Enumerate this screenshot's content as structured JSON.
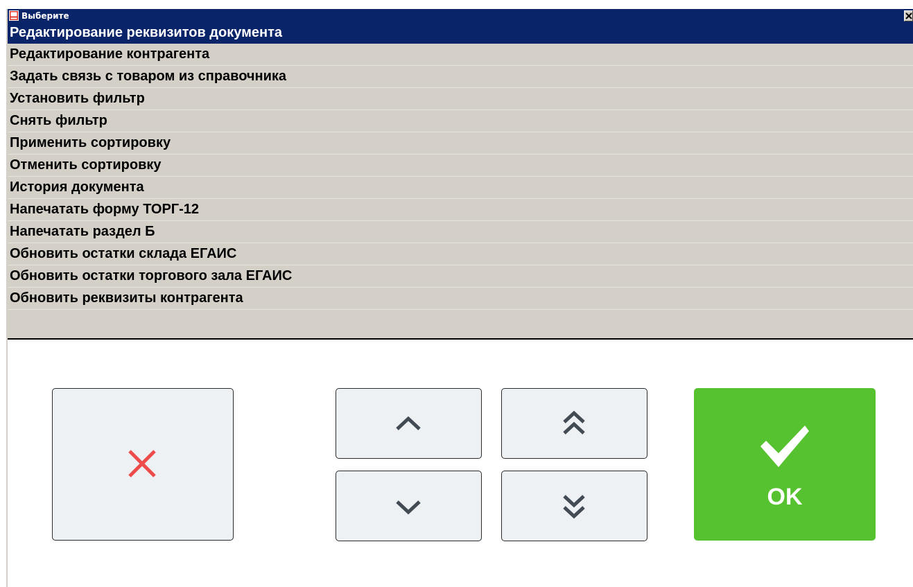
{
  "window": {
    "title": "Выберите",
    "title_icon": "app-window-icon",
    "close_icon": "close-icon"
  },
  "menu": {
    "selected_index": 0,
    "items": [
      {
        "label": "Редактирование реквизитов документа"
      },
      {
        "label": "Редактирование контрагента"
      },
      {
        "label": "Задать связь с товаром из справочника"
      },
      {
        "label": "Установить фильтр"
      },
      {
        "label": "Снять фильтр"
      },
      {
        "label": "Применить сортировку"
      },
      {
        "label": "Отменить сортировку"
      },
      {
        "label": "История документа"
      },
      {
        "label": "Напечатать форму ТОРГ-12"
      },
      {
        "label": "Напечатать раздел Б"
      },
      {
        "label": "Обновить остатки склада ЕГАИС"
      },
      {
        "label": "Обновить остатки торгового зала ЕГАИС"
      },
      {
        "label": "Обновить реквизиты контрагента"
      }
    ]
  },
  "buttons": {
    "cancel": {
      "icon": "cancel-x-icon",
      "color": "#ee4b4b"
    },
    "up": {
      "icon": "chevron-up-icon"
    },
    "page_up": {
      "icon": "double-chevron-up-icon"
    },
    "down": {
      "icon": "chevron-down-icon"
    },
    "page_down": {
      "icon": "double-chevron-down-icon"
    },
    "ok": {
      "label": "OK",
      "icon": "checkmark-icon",
      "color": "#57c22f"
    }
  },
  "colors": {
    "selection": "#0a246a",
    "list_background": "#d4d0c8",
    "icon_dark": "#424b54"
  }
}
